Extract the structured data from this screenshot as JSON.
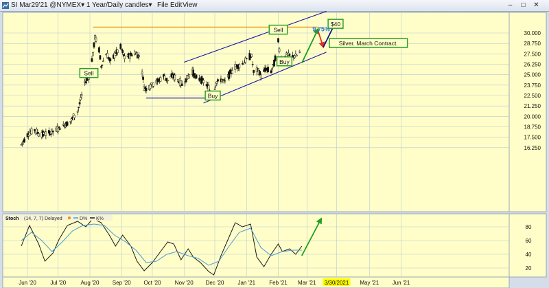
{
  "window": {
    "title": "SI Mar29'21 @NYMEX▾ 1 Year/Daily candles▾",
    "menu": [
      "File",
      "Edit",
      "View"
    ],
    "minimize_glyph": "–",
    "restore_glyph": "□",
    "close_glyph": "✕"
  },
  "chart_data": [
    {
      "type": "candlestick",
      "title": "",
      "xlabel": "",
      "ylabel": "",
      "x_ticks": [
        "Jun '20",
        "Jul '20",
        "Aug '20",
        "Sep '20",
        "Oct '20",
        "Nov '20",
        "Dec '20",
        "Jan '21",
        "Feb '21",
        "Mar '21",
        "3/30/2021",
        "May '21",
        "Jun '21"
      ],
      "highlighted_x_tick": "3/30/2021",
      "y_ticks": [
        "30.000",
        "28.750",
        "27.500",
        "26.250",
        "25.000",
        "23.750",
        "22.500",
        "21.250",
        "20.000",
        "18.750",
        "17.500",
        "16.250"
      ],
      "ylim": [
        15.4,
        31.8
      ],
      "grid": true,
      "price_path": [
        [
          "2020-05-26",
          16.6
        ],
        [
          "2020-06-01",
          17.8
        ],
        [
          "2020-06-08",
          18.4
        ],
        [
          "2020-06-12",
          17.9
        ],
        [
          "2020-06-20",
          17.9
        ],
        [
          "2020-06-28",
          18.3
        ],
        [
          "2020-07-06",
          18.9
        ],
        [
          "2020-07-13",
          19.4
        ],
        [
          "2020-07-20",
          20.6
        ],
        [
          "2020-07-24",
          22.5
        ],
        [
          "2020-07-27",
          24.0
        ],
        [
          "2020-07-31",
          24.8
        ],
        [
          "2020-08-04",
          27.5
        ],
        [
          "2020-08-06",
          29.5
        ],
        [
          "2020-08-10",
          28.0
        ],
        [
          "2020-08-12",
          26.0
        ],
        [
          "2020-08-17",
          27.5
        ],
        [
          "2020-08-21",
          26.6
        ],
        [
          "2020-08-26",
          27.5
        ],
        [
          "2020-08-31",
          28.3
        ],
        [
          "2020-09-04",
          27.0
        ],
        [
          "2020-09-09",
          27.3
        ],
        [
          "2020-09-14",
          27.6
        ],
        [
          "2020-09-18",
          27.2
        ],
        [
          "2020-09-21",
          25.4
        ],
        [
          "2020-09-23",
          23.5
        ],
        [
          "2020-09-25",
          23.3
        ],
        [
          "2020-09-30",
          23.8
        ],
        [
          "2020-10-06",
          24.2
        ],
        [
          "2020-10-12",
          24.8
        ],
        [
          "2020-10-16",
          24.3
        ],
        [
          "2020-10-21",
          24.9
        ],
        [
          "2020-10-26",
          24.3
        ],
        [
          "2020-10-30",
          23.8
        ],
        [
          "2020-11-04",
          24.6
        ],
        [
          "2020-11-09",
          25.4
        ],
        [
          "2020-11-13",
          24.6
        ],
        [
          "2020-11-18",
          24.4
        ],
        [
          "2020-11-23",
          23.8
        ],
        [
          "2020-11-27",
          22.9
        ],
        [
          "2020-11-30",
          22.8
        ],
        [
          "2020-12-02",
          24.0
        ],
        [
          "2020-12-07",
          24.4
        ],
        [
          "2020-12-11",
          24.2
        ],
        [
          "2020-12-16",
          25.2
        ],
        [
          "2020-12-21",
          25.9
        ],
        [
          "2020-12-28",
          26.3
        ],
        [
          "2021-01-04",
          27.2
        ],
        [
          "2021-01-06",
          27.2
        ],
        [
          "2021-01-08",
          25.3
        ],
        [
          "2021-01-12",
          25.6
        ],
        [
          "2021-01-15",
          24.9
        ],
        [
          "2021-01-20",
          25.7
        ],
        [
          "2021-01-25",
          25.4
        ],
        [
          "2021-01-28",
          26.4
        ],
        [
          "2021-02-01",
          29.0
        ],
        [
          "2021-02-03",
          26.9
        ],
        [
          "2021-02-05",
          26.8
        ],
        [
          "2021-02-10",
          27.4
        ],
        [
          "2021-02-15",
          27.2
        ],
        [
          "2021-02-19",
          27.3
        ],
        [
          "2021-02-23",
          27.8
        ]
      ],
      "resistance_level": 30.7,
      "support_level": 22.2,
      "upper_channel": [
        [
          "2020-11-01",
          26.5
        ],
        [
          "2021-03-20",
          32.6
        ]
      ],
      "lower_channel": [
        [
          "2020-11-20",
          21.6
        ],
        [
          "2021-03-20",
          27.7
        ]
      ],
      "annotations": [
        {
          "text": "Sell",
          "date": "2020-07-31",
          "value": 25.2
        },
        {
          "text": "Buy",
          "date": "2020-11-29",
          "value": 22.5
        },
        {
          "text": "Sell",
          "date": "2021-02-01",
          "value": 30.4
        },
        {
          "text": "Buy",
          "date": "2021-02-07",
          "value": 26.6
        },
        {
          "text": "$40",
          "date": "2021-03-29",
          "value": 31.1
        },
        {
          "text": "Silver. March Contract.",
          "date": "2021-04-30",
          "value": 28.8
        },
        {
          "text": "9.75%",
          "date": "2021-03-15",
          "value": 30.2
        }
      ],
      "arrows": [
        {
          "color": "#1fa01f",
          "from": [
            "2021-02-24",
            26.4
          ],
          "to": [
            "2021-03-12",
            30.5
          ]
        },
        {
          "color": "#e03020",
          "from": [
            "2021-03-12",
            30.2
          ],
          "to": [
            "2021-03-17",
            28.3
          ]
        },
        {
          "color": "#101090",
          "from": [
            "2021-03-17",
            28.3
          ],
          "to": [
            "2021-03-29",
            31.3
          ]
        }
      ]
    },
    {
      "type": "line",
      "title": "Stoch (14, 7, 7) Delayed ●  ─ D%  ─ K%",
      "title_parts": {
        "name": "Stoch",
        "params": "(14, 7, 7) Delayed",
        "d_label": "D%",
        "k_label": "K%"
      },
      "y_ticks": [
        "80",
        "60",
        "40",
        "20"
      ],
      "ylim": [
        0,
        100
      ],
      "series": [
        {
          "name": "K%",
          "color": "#1a1a1a",
          "points": [
            [
              "2020-05-26",
              52
            ],
            [
              "2020-06-03",
              82
            ],
            [
              "2020-06-12",
              55
            ],
            [
              "2020-06-18",
              30
            ],
            [
              "2020-06-26",
              42
            ],
            [
              "2020-07-02",
              62
            ],
            [
              "2020-07-10",
              82
            ],
            [
              "2020-07-20",
              88
            ],
            [
              "2020-07-28",
              80
            ],
            [
              "2020-08-04",
              92
            ],
            [
              "2020-08-12",
              86
            ],
            [
              "2020-08-20",
              68
            ],
            [
              "2020-08-26",
              52
            ],
            [
              "2020-09-02",
              68
            ],
            [
              "2020-09-10",
              52
            ],
            [
              "2020-09-16",
              30
            ],
            [
              "2020-09-23",
              16
            ],
            [
              "2020-10-01",
              28
            ],
            [
              "2020-10-08",
              42
            ],
            [
              "2020-10-16",
              58
            ],
            [
              "2020-10-22",
              55
            ],
            [
              "2020-10-29",
              32
            ],
            [
              "2020-11-05",
              48
            ],
            [
              "2020-11-10",
              36
            ],
            [
              "2020-11-17",
              28
            ],
            [
              "2020-11-25",
              15
            ],
            [
              "2020-11-30",
              10
            ],
            [
              "2020-12-07",
              38
            ],
            [
              "2020-12-14",
              62
            ],
            [
              "2020-12-21",
              86
            ],
            [
              "2020-12-28",
              80
            ],
            [
              "2021-01-05",
              84
            ],
            [
              "2021-01-11",
              36
            ],
            [
              "2021-01-18",
              22
            ],
            [
              "2021-01-25",
              40
            ],
            [
              "2021-02-01",
              55
            ],
            [
              "2021-02-05",
              44
            ],
            [
              "2021-02-12",
              48
            ],
            [
              "2021-02-18",
              40
            ],
            [
              "2021-02-24",
              52
            ]
          ]
        },
        {
          "name": "D%",
          "color": "#4a9ad8",
          "points": [
            [
              "2020-05-26",
              60
            ],
            [
              "2020-06-05",
              72
            ],
            [
              "2020-06-15",
              60
            ],
            [
              "2020-06-25",
              44
            ],
            [
              "2020-07-05",
              58
            ],
            [
              "2020-07-15",
              74
            ],
            [
              "2020-07-25",
              82
            ],
            [
              "2020-08-05",
              84
            ],
            [
              "2020-08-15",
              82
            ],
            [
              "2020-08-25",
              68
            ],
            [
              "2020-09-05",
              58
            ],
            [
              "2020-09-15",
              46
            ],
            [
              "2020-09-25",
              28
            ],
            [
              "2020-10-05",
              30
            ],
            [
              "2020-10-15",
              40
            ],
            [
              "2020-10-25",
              44
            ],
            [
              "2020-11-05",
              38
            ],
            [
              "2020-11-15",
              34
            ],
            [
              "2020-11-25",
              24
            ],
            [
              "2020-12-05",
              30
            ],
            [
              "2020-12-15",
              52
            ],
            [
              "2020-12-25",
              72
            ],
            [
              "2021-01-05",
              78
            ],
            [
              "2021-01-15",
              50
            ],
            [
              "2021-01-25",
              38
            ],
            [
              "2021-02-05",
              44
            ],
            [
              "2021-02-15",
              46
            ],
            [
              "2021-02-24",
              46
            ]
          ]
        }
      ],
      "arrow": {
        "color": "#1fa01f",
        "from": [
          "2021-02-24",
          38
        ],
        "to": [
          "2021-03-15",
          92
        ]
      }
    }
  ]
}
